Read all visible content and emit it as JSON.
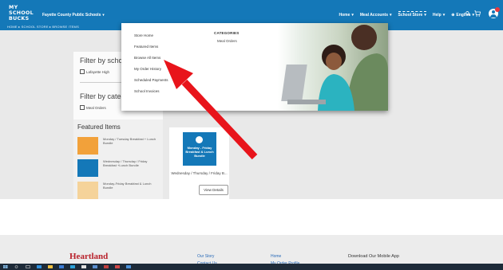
{
  "header": {
    "logo_text": "MY SCHOOL BUCKS",
    "district": "Fayette County Public Schools",
    "nav": [
      {
        "label": "Home"
      },
      {
        "label": "Meal Accounts"
      },
      {
        "label": "School Store"
      },
      {
        "label": "Help"
      },
      {
        "label": "English"
      }
    ],
    "icons": [
      "search-icon",
      "cart-icon",
      "user-avatar-icon"
    ]
  },
  "breadcrumb": "HOME ▸ SCHOOL STORE ▸ BROWSE ITEMS",
  "filters": {
    "school_title": "Filter by school",
    "school_option": "Lafayette High",
    "category_title": "Filter by category",
    "category_option": "Meal Orders"
  },
  "featured": {
    "title": "Featured Items",
    "items": [
      {
        "label": "Monday / Tuesday Breakfast + Lunch Bundle"
      },
      {
        "label": "Wednesday / Thursday / Friday Breakfast +Lunch Bundle"
      },
      {
        "label": "Monday-Friday Breakfast & Lunch Bundle"
      }
    ]
  },
  "product": {
    "image_text": "Monday - Friday Breakfast & Lunch Bundle",
    "caption": "Wednesday / Thursday / Friday B...",
    "button": "View Details"
  },
  "dropdown": {
    "links": [
      {
        "label": "Store Home"
      },
      {
        "label": "Featured Items"
      },
      {
        "label": "Browse All Items"
      },
      {
        "label": "My Order History"
      },
      {
        "label": "Scheduled Payments"
      },
      {
        "label": "School Invoices"
      }
    ],
    "categories_title": "CATEGORIES",
    "category": "Meal Orders"
  },
  "footer": {
    "brand": "Heartland",
    "col1": [
      "Our Story",
      "Contact Us"
    ],
    "col2": [
      "Home",
      "My Order Profile"
    ],
    "download": "Download Our Mobile App"
  },
  "colors": {
    "nav_bg": "#1478b8",
    "arrow": "#e8141b",
    "brand": "#b8202a"
  }
}
